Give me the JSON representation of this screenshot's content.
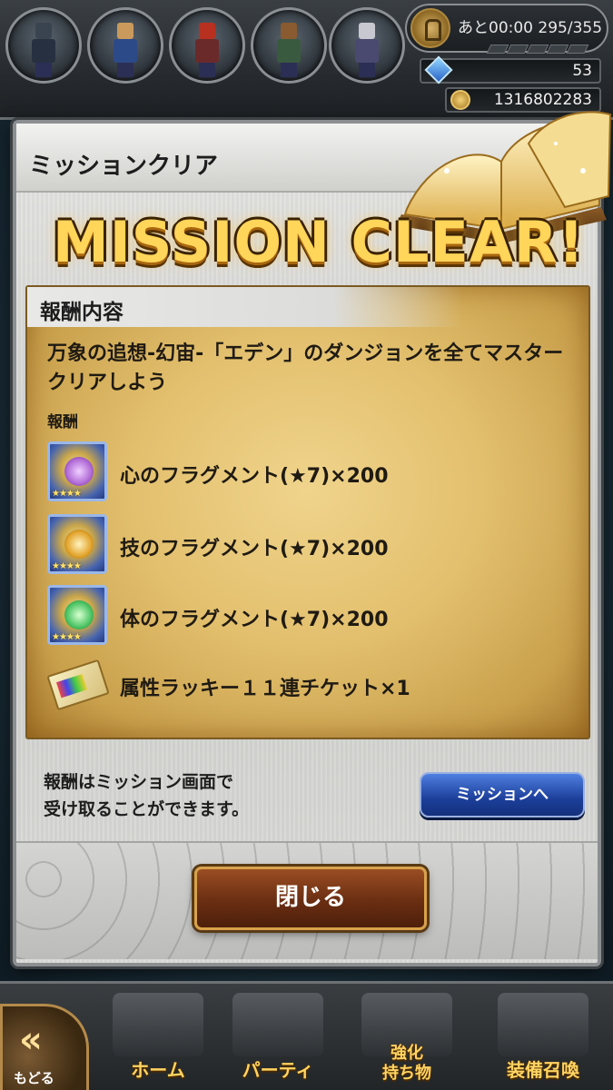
{
  "header": {
    "stamina": "あと00:00 295/355",
    "gems": "53",
    "gil": "1316802283"
  },
  "party_portraits": [
    {
      "name": "Dark Knight",
      "head": "#3a4450",
      "body": "#263040"
    },
    {
      "name": "Bartz",
      "head": "#c99a5c",
      "body": "#2d4a88"
    },
    {
      "name": "Red-haired Hero",
      "head": "#b83020",
      "body": "#6a2a2a"
    },
    {
      "name": "Brown-haired Hero",
      "head": "#8a5a30",
      "body": "#3a5a40"
    },
    {
      "name": "Silver-haired Hero",
      "head": "#c8c8d0",
      "body": "#4a4a70"
    }
  ],
  "dialog": {
    "title": "ミッションクリア",
    "banner": "MISSION CLEAR!",
    "reward_section_title": "報酬内容",
    "mission_description": "万象の追想-幻宙-「エデン」のダンジョンを全てマスタークリアしよう",
    "reward_label": "報酬",
    "rewards": [
      {
        "name": "心のフラグメント(★7)×200",
        "orb_color": "#b06ad6",
        "icon": "heart-fragment-icon"
      },
      {
        "name": "技のフラグメント(★7)×200",
        "orb_color": "#e2a42c",
        "icon": "skill-fragment-icon"
      },
      {
        "name": "体のフラグメント(★7)×200",
        "orb_color": "#4cc464",
        "icon": "body-fragment-icon"
      },
      {
        "name": "属性ラッキー１１連チケット×1",
        "icon": "ticket-icon"
      }
    ],
    "notice_line1": "報酬はミッション画面で",
    "notice_line2": "受け取ることができます。",
    "mission_button": "ミッションへ",
    "close_button": "閉じる"
  },
  "bottom_nav": {
    "back": "もどる",
    "home": "ホーム",
    "party": "パーティ",
    "enhance_line1": "強化",
    "enhance_line2": "持ち物",
    "summon": "装備召喚"
  }
}
